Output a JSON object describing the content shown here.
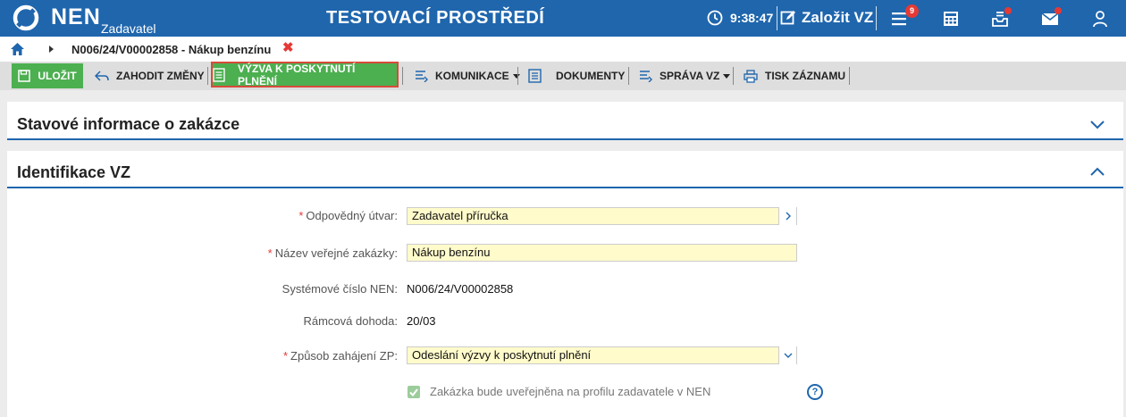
{
  "header": {
    "logo_text": "NEN",
    "logo_subtitle": "Zadavatel",
    "environment_title": "TESTOVACÍ PROSTŘEDÍ",
    "clock_time": "9:38:47",
    "create_vz_label": "Založit VZ",
    "tasks_badge": "9",
    "icons": [
      "clock-icon",
      "edit-icon",
      "menu-list-icon",
      "calculator-icon",
      "inbox-icon",
      "mail-icon",
      "user-icon"
    ]
  },
  "breadcrumb": {
    "current": "N006/24/V00002858 - Nákup benzínu",
    "close_symbol": "✖"
  },
  "toolbar": {
    "save_label": "ULOŽIT",
    "discard_label": "ZAHODIT ZMĚNY",
    "vyzva_label": "VÝZVA K POSKYTNUTÍ PLNĚNÍ",
    "komunikace_label": "KOMUNIKACE",
    "dokumenty_label": "DOKUMENTY",
    "sprava_label": "SPRÁVA VZ",
    "tisk_label": "TISK ZÁZNAMU"
  },
  "panels": {
    "status_title": "Stavové informace o zakázce",
    "status_expanded": false,
    "identification_title": "Identifikace VZ",
    "identification_expanded": true
  },
  "form": {
    "responsible_unit_label": "Odpovědný útvar:",
    "responsible_unit_value": "Zadavatel příručka",
    "contract_name_label": "Název veřejné zakázky:",
    "contract_name_value": "Nákup benzínu",
    "system_number_label": "Systémové číslo NEN:",
    "system_number_value": "N006/24/V00002858",
    "framework_label": "Rámcová dohoda:",
    "framework_value": "20/03",
    "initiation_label": "Způsob zahájení ZP:",
    "initiation_value": "Odeslání výzvy k poskytnutí plnění",
    "publish_checkbox_label": "Zakázka bude uveřejněna na profilu zadavatele v NEN",
    "publish_checked": true,
    "help_symbol": "?"
  },
  "colors": {
    "header_blue": "#1f66ad",
    "accent_green": "#4caf50",
    "required_red": "#e53935",
    "input_yellow": "#fffbcb"
  }
}
